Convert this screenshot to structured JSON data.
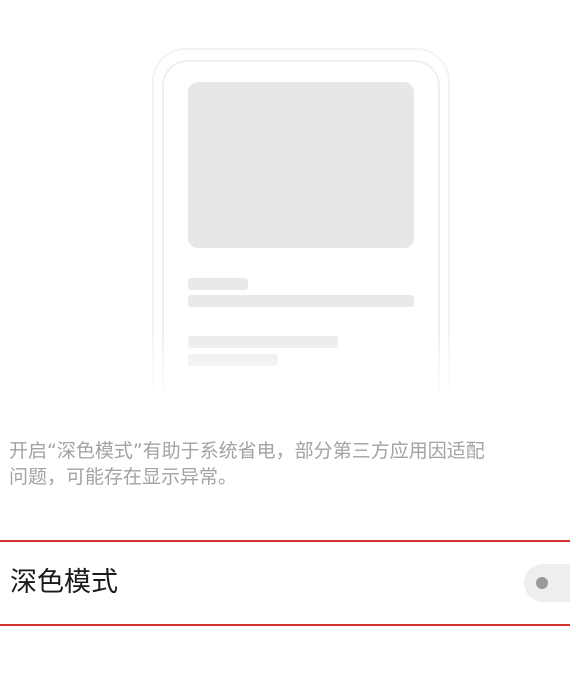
{
  "illustration": {
    "icon": "phone-preview-placeholder"
  },
  "description": {
    "line1": "开启“深色模式”有助于系统省电，部分第三方应用因适配",
    "line2": "问题，可能存在显示异常。"
  },
  "dark_mode_setting": {
    "label": "深色模式",
    "enabled": false
  },
  "colors": {
    "highlight_border": "#d0342c",
    "description_text": "#a3a3a3",
    "toggle_off_track": "#eeeeee"
  }
}
